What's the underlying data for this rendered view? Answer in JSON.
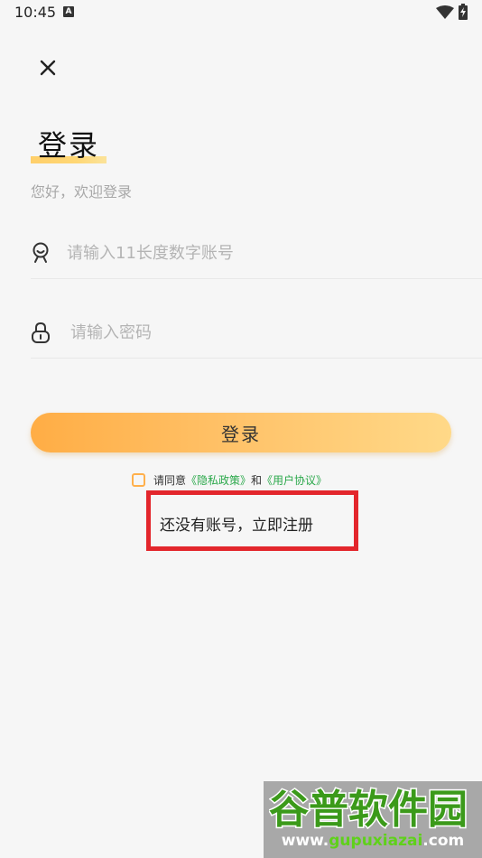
{
  "status_bar": {
    "time": "10:45",
    "notification_letter": "A"
  },
  "login": {
    "title": "登录",
    "subtitle": "您好，欢迎登录",
    "account_placeholder": "请输入11长度数字账号",
    "password_placeholder": "请输入密码",
    "login_button": "登录",
    "agree_prefix": "请同意",
    "privacy_link": "《隐私政策》",
    "agree_and": "和",
    "terms_link": "《用户协议》",
    "register_link": "还没有账号，立即注册"
  },
  "watermark": {
    "logo_text": "谷普软件园",
    "url_prefix": "www.",
    "url_brand": "gupuxiazai",
    "url_suffix": ".com"
  },
  "colors": {
    "accent_orange": "#ffad45",
    "link_green": "#2aa84a",
    "highlight_red": "#e3262c"
  }
}
